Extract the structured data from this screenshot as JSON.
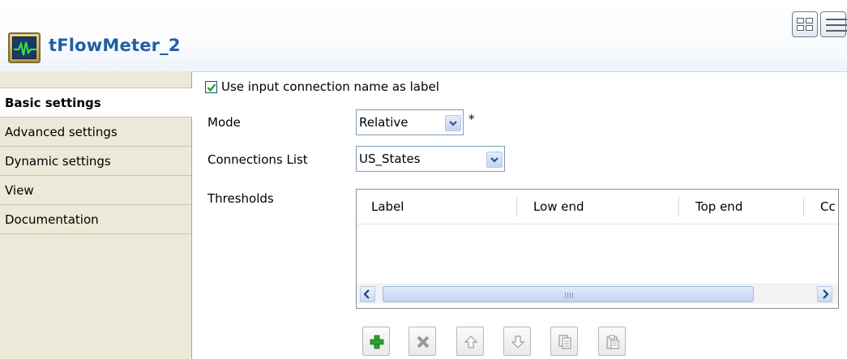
{
  "component": {
    "title": "tFlowMeter_2",
    "icon": "flow-meter-icon"
  },
  "layout_buttons": [
    "grid-layout-icon",
    "list-layout-icon"
  ],
  "nav": {
    "items": [
      {
        "label": "Basic settings",
        "active": true
      },
      {
        "label": "Advanced settings",
        "active": false
      },
      {
        "label": "Dynamic settings",
        "active": false
      },
      {
        "label": "View",
        "active": false
      },
      {
        "label": "Documentation",
        "active": false
      }
    ]
  },
  "settings": {
    "use_input_label": "Use input connection name as label",
    "use_input_checked": true,
    "mode_label": "Mode",
    "mode_value": "Relative",
    "mode_required": "*",
    "connections_label": "Connections List",
    "connections_value": "US_States",
    "thresholds_label": "Thresholds"
  },
  "thresholds_table": {
    "columns": [
      "Label",
      "Low end",
      "Top end",
      "Cc"
    ],
    "rows": []
  },
  "toolbar": [
    "add-icon",
    "remove-icon",
    "move-up-icon",
    "move-down-icon",
    "copy-icon",
    "paste-icon"
  ],
  "colors": {
    "title": "#1f5fa6",
    "nav_bg": "#ece9d8",
    "check": "#21a121",
    "add_green": "#2f9e2f"
  }
}
